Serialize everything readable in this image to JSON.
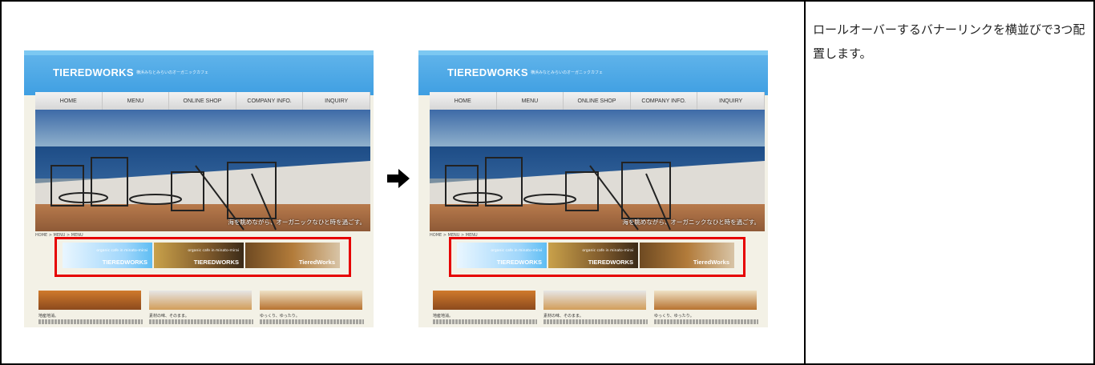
{
  "description": "ロールオーバーするバナーリンクを横並びで3つ配置します。",
  "site": {
    "logo": "TIEREDWORKS",
    "tagline": "横浜みなとみらいのオーガニックカフェ",
    "nav": [
      "HOME",
      "MENU",
      "ONLINE SHOP",
      "COMPANY INFO.",
      "INQUIRY"
    ],
    "hero_caption": "海を眺めながら、オーガニックなひと時を過ごす。",
    "breadcrumb": "HOME > MENU > MENU",
    "banners": [
      {
        "sub": "organic cafe in minato-mirai",
        "label": "TIEREDWORKS"
      },
      {
        "sub": "organic cafe in minato-mirai",
        "label": "TIEREDWORKS"
      },
      {
        "sub": "",
        "label": "TieredWorks"
      }
    ],
    "captions": [
      "地産地消。",
      "素材の味、そのまま。",
      "ゆっくり、ゆったり。"
    ]
  },
  "colors": {
    "highlight": "#e60000",
    "header": "#3f9fe2",
    "arrow": "#000000"
  }
}
